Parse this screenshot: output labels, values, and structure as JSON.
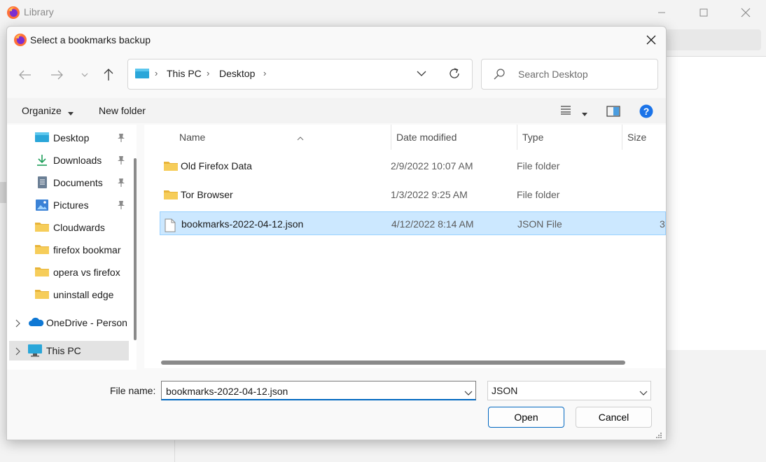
{
  "background_window": {
    "title": "Library"
  },
  "dialog": {
    "title": "Select a bookmarks backup",
    "address": {
      "crumbs": [
        "This PC",
        "Desktop"
      ]
    },
    "search": {
      "placeholder": "Search Desktop"
    },
    "toolbar": {
      "organize_label": "Organize",
      "new_folder_label": "New folder"
    },
    "nav_pane": {
      "items": [
        {
          "label": "Desktop",
          "icon": "desktop-icon",
          "pinned": true
        },
        {
          "label": "Downloads",
          "icon": "download-icon",
          "pinned": true
        },
        {
          "label": "Documents",
          "icon": "document-icon",
          "pinned": true
        },
        {
          "label": "Pictures",
          "icon": "pictures-icon",
          "pinned": true
        },
        {
          "label": "Cloudwards",
          "icon": "folder-icon",
          "pinned": false
        },
        {
          "label": "firefox bookmar",
          "icon": "folder-icon",
          "pinned": false
        },
        {
          "label": "opera vs firefox",
          "icon": "folder-icon",
          "pinned": false
        },
        {
          "label": "uninstall edge",
          "icon": "folder-icon",
          "pinned": false
        },
        {
          "label": "OneDrive - Person",
          "icon": "onedrive-icon",
          "pinned": false
        },
        {
          "label": "This PC",
          "icon": "pc-icon",
          "pinned": false
        }
      ]
    },
    "file_list": {
      "columns": [
        "Name",
        "Date modified",
        "Type",
        "Size"
      ],
      "rows": [
        {
          "name": "Old Firefox Data",
          "date": "2/9/2022 10:07 AM",
          "type": "File folder",
          "size": "",
          "icon": "folder-icon",
          "selected": false
        },
        {
          "name": "Tor Browser",
          "date": "1/3/2022 9:25 AM",
          "type": "File folder",
          "size": "",
          "icon": "folder-icon",
          "selected": false
        },
        {
          "name": "bookmarks-2022-04-12.json",
          "date": "4/12/2022 8:14 AM",
          "type": "JSON File",
          "size": "3",
          "icon": "file-icon",
          "selected": true
        }
      ]
    },
    "file_name": {
      "label": "File name:",
      "value": "bookmarks-2022-04-12.json"
    },
    "file_type": {
      "value": "JSON"
    },
    "buttons": {
      "open": "Open",
      "cancel": "Cancel"
    },
    "colors": {
      "accent": "#0067c0",
      "selection": "#cce8ff",
      "folder": "#f2c94c"
    }
  }
}
